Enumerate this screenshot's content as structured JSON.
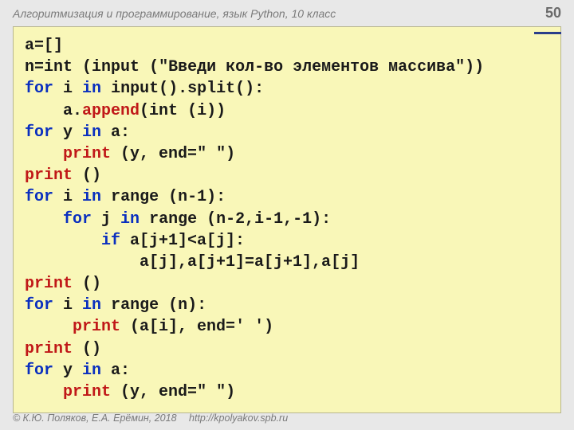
{
  "header": {
    "title": "Алгоритмизация и программирование, язык Python, 10 класс",
    "page_number": "50"
  },
  "code": {
    "l1_a": "a=[]",
    "l2_a": "n=",
    "l2_b": "int",
    "l2_c": " (",
    "l2_d": "input",
    "l2_e": " (",
    "l2_f": "\"Введи кол-во элементов массива\"",
    "l2_g": "))",
    "l3_a": "for",
    "l3_b": " i ",
    "l3_c": "in",
    "l3_d": " ",
    "l3_e": "input",
    "l3_f": "().split():",
    "l4_a": "    a.",
    "l4_b": "append",
    "l4_c": "(",
    "l4_d": "int",
    "l4_e": " (i))",
    "l5_a": "for",
    "l5_b": " y ",
    "l5_c": "in",
    "l5_d": " a:",
    "l6_a": "    ",
    "l6_b": "print",
    "l6_c": " (y, end=",
    "l6_d": "\" \"",
    "l6_e": ")",
    "l7_a": "print",
    "l7_b": " ()",
    "l8_a": "for",
    "l8_b": " i ",
    "l8_c": "in",
    "l8_d": " ",
    "l8_e": "range",
    "l8_f": " (n-1):",
    "l9_a": "    ",
    "l9_b": "for",
    "l9_c": " j ",
    "l9_d": "in",
    "l9_e": " ",
    "l9_f": "range",
    "l9_g": " (n-2,i-1,-1):",
    "l10_a": "        ",
    "l10_b": "if",
    "l10_c": " a[j+1]<a[j]:",
    "l11_a": "            a[j],a[j+1]=a[j+1],a[j]",
    "l12_a": "print",
    "l12_b": " ()",
    "l13_a": "for",
    "l13_b": " i ",
    "l13_c": "in",
    "l13_d": " ",
    "l13_e": "range",
    "l13_f": " (n):",
    "l14_a": "     ",
    "l14_b": "print",
    "l14_c": " (a[i], end=",
    "l14_d": "' '",
    "l14_e": ")",
    "l15_a": "print",
    "l15_b": " ()",
    "l16_a": "for",
    "l16_b": " y ",
    "l16_c": "in",
    "l16_d": " a:",
    "l17_a": "    ",
    "l17_b": "print",
    "l17_c": " (y, end=",
    "l17_d": "\" \"",
    "l17_e": ")"
  },
  "footer": {
    "copyright": "© К.Ю. Поляков, Е.А. Ерёмин, 2018",
    "url": "http://kpolyakov.spb.ru"
  }
}
